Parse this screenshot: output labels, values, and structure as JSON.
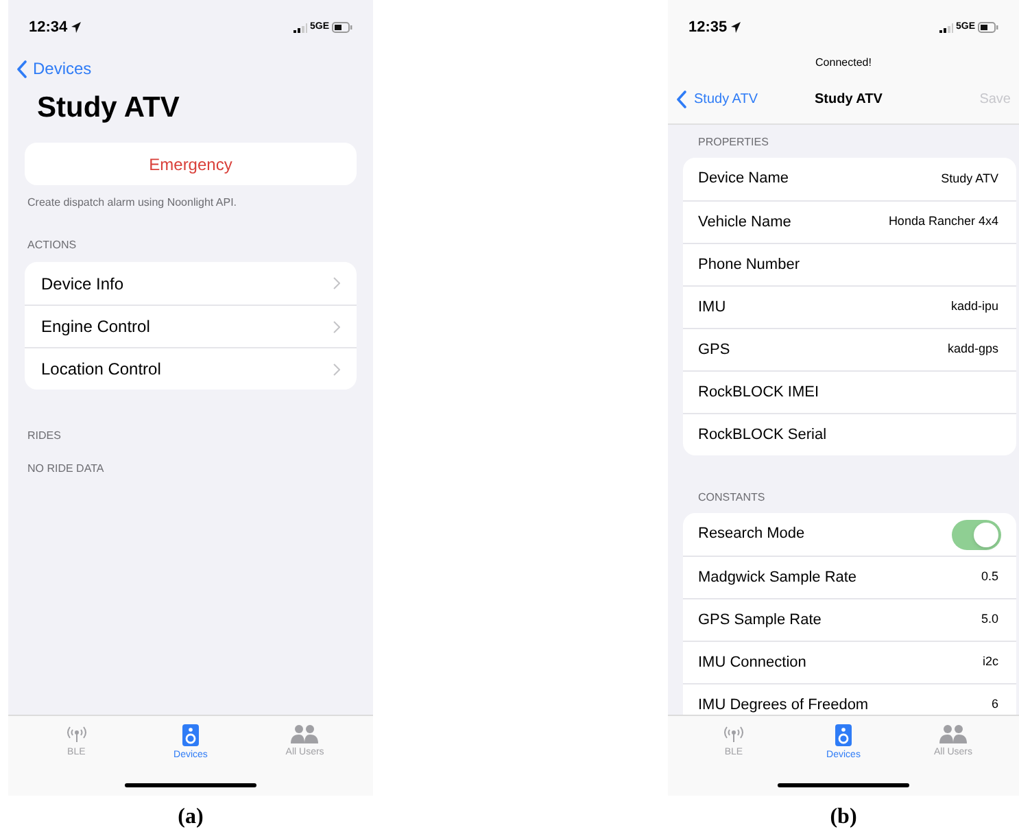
{
  "panels": [
    {
      "kind": "detail",
      "caption": "(a)",
      "status": {
        "time": "12:34",
        "network": "5GE"
      },
      "back": "Devices",
      "title": "Study ATV",
      "emergency": {
        "label": "Emergency",
        "note": "Create dispatch alarm using Noonlight API."
      },
      "sections": [
        {
          "header": "ACTIONS",
          "rows": [
            {
              "label": "Device Info"
            },
            {
              "label": "Engine Control"
            },
            {
              "label": "Location Control"
            }
          ]
        },
        {
          "header": "RIDES",
          "empty": "NO RIDE DATA"
        }
      ],
      "tab_bar": [
        {
          "label": "BLE",
          "selected": false
        },
        {
          "label": "Devices",
          "selected": true
        },
        {
          "label": "All Users",
          "selected": false
        }
      ]
    },
    {
      "kind": "form",
      "caption": "(b)",
      "status": {
        "time": "12:35",
        "network": "5GE"
      },
      "banner": "Connected!",
      "back": "Study ATV",
      "title": "Study ATV",
      "save": {
        "label": "Save",
        "disabled": true
      },
      "sections": [
        {
          "header": "PROPERTIES",
          "rows": [
            {
              "kind": "value",
              "label": "Device Name",
              "value": "Study ATV"
            },
            {
              "kind": "value",
              "label": "Vehicle Name",
              "value": "Honda Rancher 4x4"
            },
            {
              "kind": "value",
              "label": "Phone Number"
            },
            {
              "kind": "value",
              "label": "IMU",
              "value": "kadd-ipu"
            },
            {
              "kind": "value",
              "label": "GPS",
              "value": "kadd-gps"
            },
            {
              "kind": "value",
              "label": "RockBLOCK IMEI"
            },
            {
              "kind": "value",
              "label": "RockBLOCK Serial"
            }
          ]
        },
        {
          "header": "CONSTANTS",
          "rows": [
            {
              "kind": "toggle",
              "label": "Research Mode",
              "on": true
            },
            {
              "kind": "value",
              "label": "Madgwick Sample Rate",
              "value": "0.5"
            },
            {
              "kind": "value",
              "label": "GPS Sample Rate",
              "value": "5.0"
            },
            {
              "kind": "value",
              "label": "IMU Connection",
              "value": "i2c"
            },
            {
              "kind": "value",
              "label": "IMU Degrees of Freedom",
              "value": "6"
            }
          ]
        }
      ],
      "tab_bar": [
        {
          "label": "BLE",
          "selected": false
        },
        {
          "label": "Devices",
          "selected": true
        },
        {
          "label": "All Users",
          "selected": false
        }
      ]
    }
  ]
}
